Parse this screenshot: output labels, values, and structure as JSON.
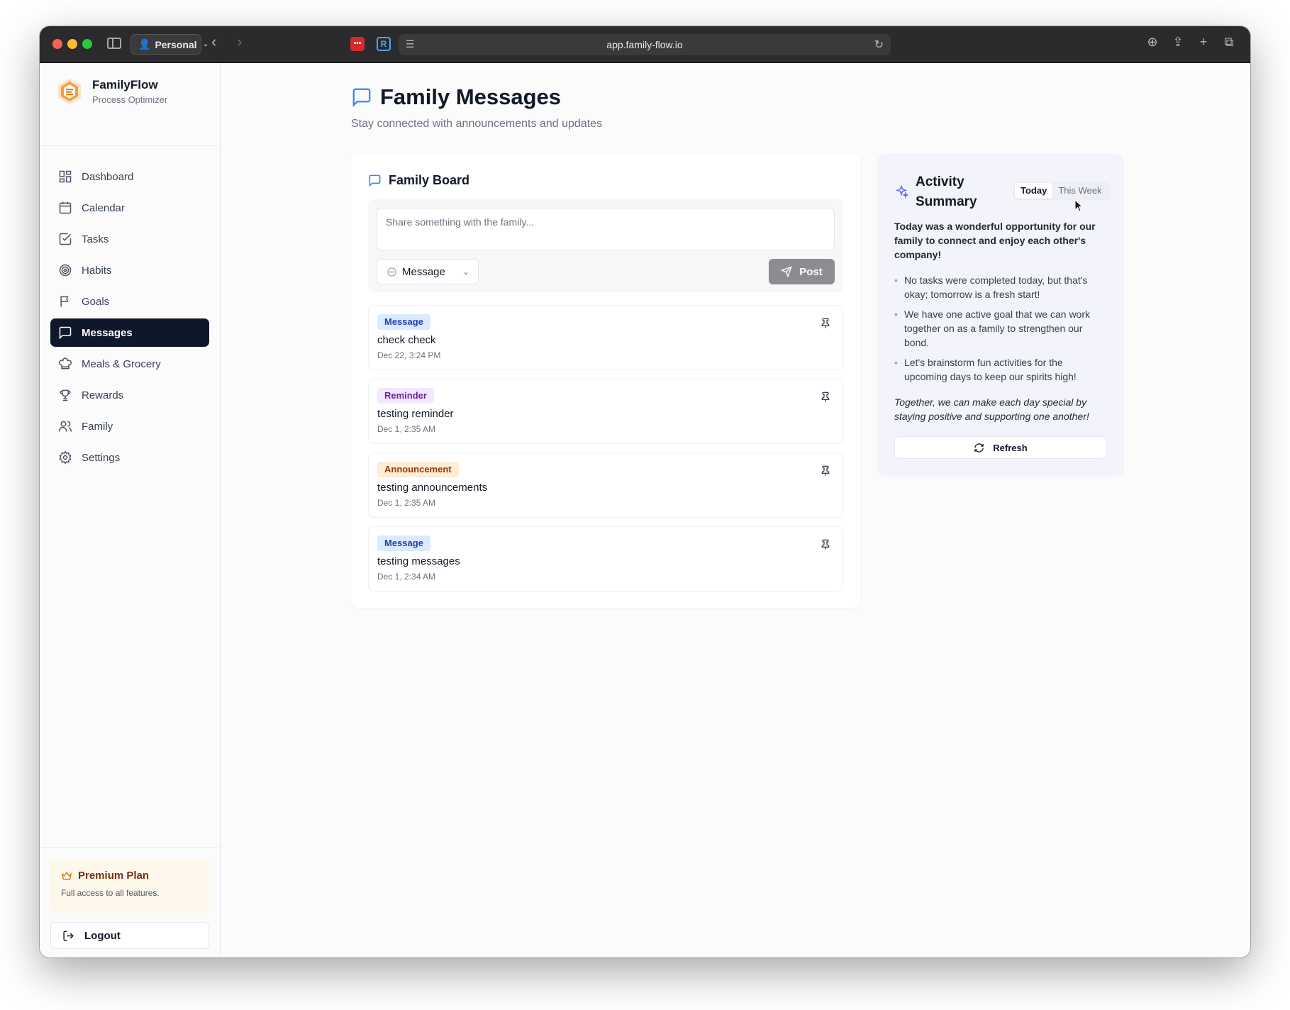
{
  "browser": {
    "profile_label": "Personal",
    "url": "app.family-flow.io"
  },
  "brand": {
    "name": "FamilyFlow",
    "subtitle": "Process Optimizer"
  },
  "nav": {
    "items": [
      {
        "label": "Dashboard",
        "icon": "dashboard-icon"
      },
      {
        "label": "Calendar",
        "icon": "calendar-icon"
      },
      {
        "label": "Tasks",
        "icon": "checkbox-icon"
      },
      {
        "label": "Habits",
        "icon": "target-icon"
      },
      {
        "label": "Goals",
        "icon": "flag-icon"
      },
      {
        "label": "Messages",
        "icon": "message-icon",
        "active": true
      },
      {
        "label": "Meals & Grocery",
        "icon": "chef-hat-icon"
      },
      {
        "label": "Rewards",
        "icon": "trophy-icon"
      },
      {
        "label": "Family",
        "icon": "users-icon"
      },
      {
        "label": "Settings",
        "icon": "gear-icon"
      }
    ]
  },
  "premium": {
    "title": "Premium Plan",
    "subtitle": "Full access to all features."
  },
  "logout_label": "Logout",
  "page": {
    "title": "Family Messages",
    "subtitle": "Stay connected with announcements and updates"
  },
  "board": {
    "title": "Family Board",
    "composer_placeholder": "Share something with the family...",
    "type_selected": "Message",
    "post_label": "Post",
    "posts": [
      {
        "tag": "Message",
        "text": "check check",
        "date": "Dec 22, 3:24 PM"
      },
      {
        "tag": "Reminder",
        "text": "testing reminder",
        "date": "Dec 1, 2:35 AM"
      },
      {
        "tag": "Announcement",
        "text": "testing announcements",
        "date": "Dec 1, 2:35 AM"
      },
      {
        "tag": "Message",
        "text": "testing messages",
        "date": "Dec 1, 2:34 AM"
      }
    ]
  },
  "activity": {
    "title": "Activity Summary",
    "tabs": [
      "Today",
      "This Week"
    ],
    "selected_tab": "Today",
    "intro": "Today was a wonderful opportunity for our family to connect and enjoy each other's company!",
    "bullets": [
      "No tasks were completed today, but that's okay; tomorrow is a fresh start!",
      "We have one active goal that we can work together on as a family to strengthen our bond.",
      "Let's brainstorm fun activities for the upcoming days to keep our spirits high!"
    ],
    "outro": "Together, we can make each day special by staying positive and supporting one another!",
    "refresh_label": "Refresh"
  },
  "colors": {
    "active_nav_bg": "#0f172a",
    "accent_blue": "#3b82f6",
    "activity_bg": "#f3f3fc"
  }
}
